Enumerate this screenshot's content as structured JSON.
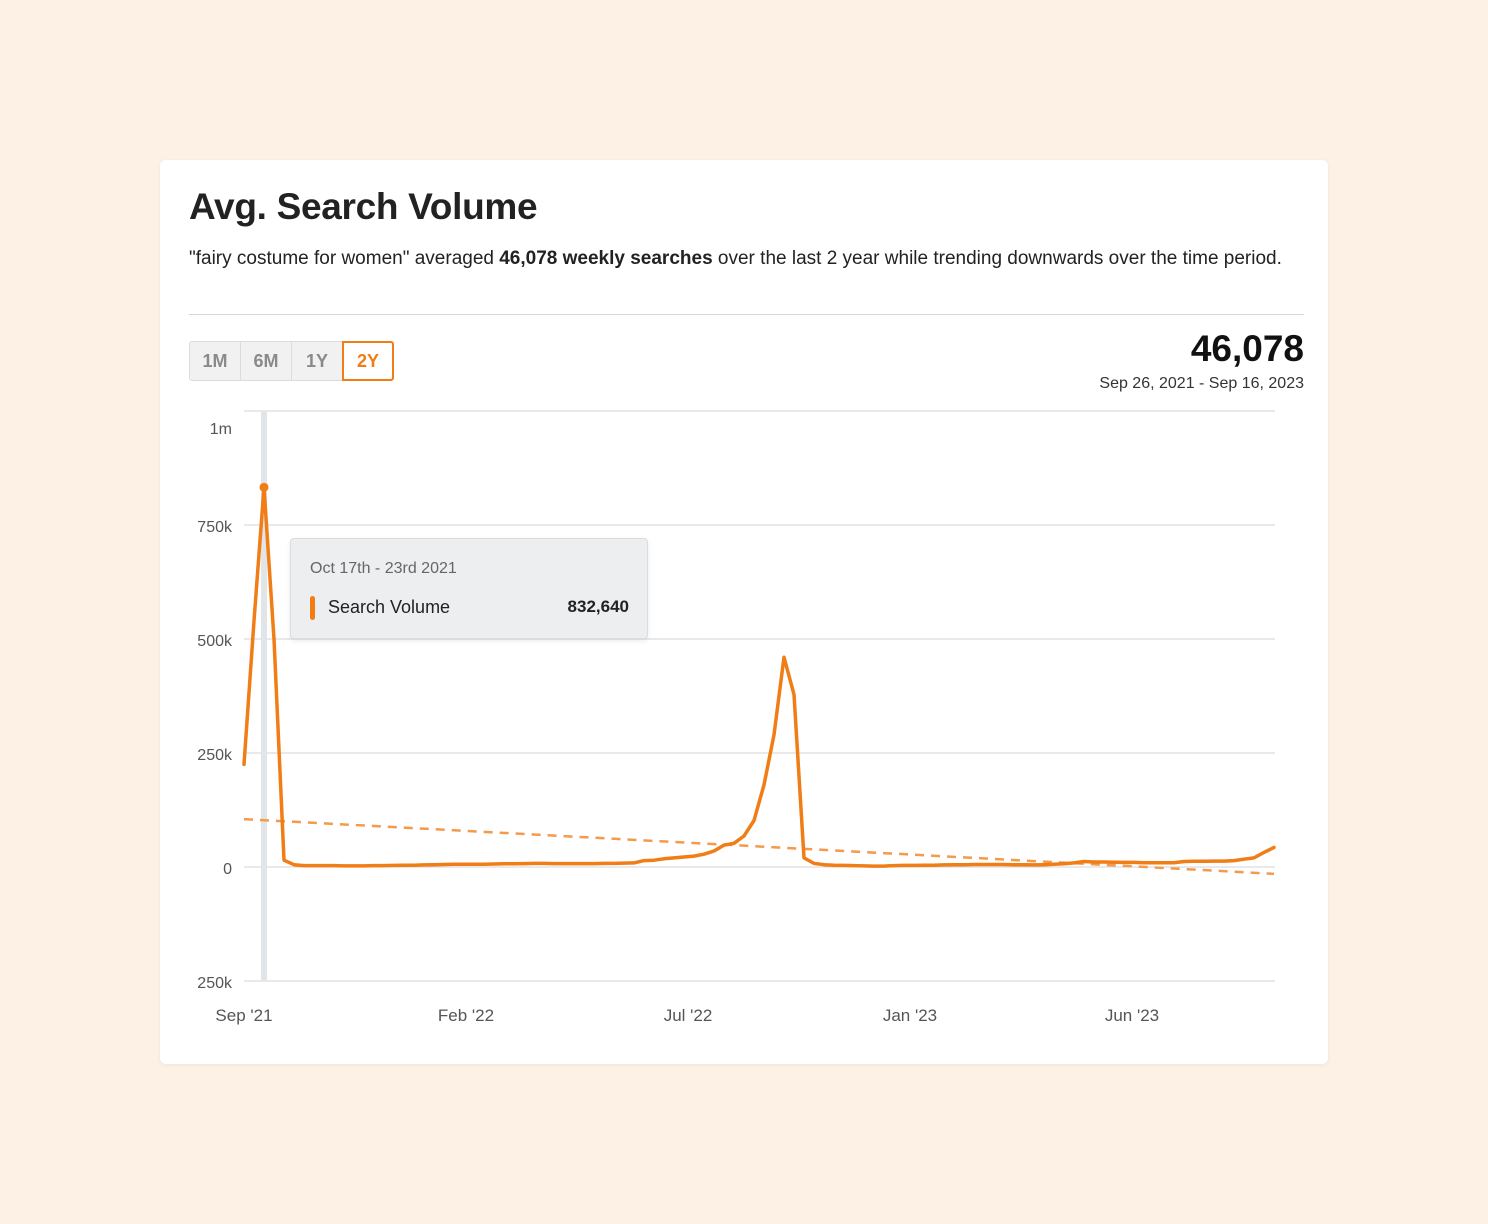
{
  "card": {
    "title": "Avg. Search Volume",
    "desc_pre": "\"fairy costume for women\" averaged ",
    "desc_bold": "46,078 weekly searches",
    "desc_post": " over the last 2 year while trending downwards over the time period."
  },
  "range_buttons": [
    "1M",
    "6M",
    "1Y",
    "2Y"
  ],
  "active_range": "2Y",
  "summary": {
    "value": "46,078",
    "date_range": "Sep 26, 2021 - Sep 16, 2023"
  },
  "tooltip": {
    "date": "Oct 17th - 23rd 2021",
    "series": "Search Volume",
    "value": "832,640"
  },
  "colors": {
    "accent": "#f07d16",
    "trend": "#f39a4c",
    "grid": "#d3d3d3",
    "cursor": "#e2e5e8"
  },
  "chart_data": {
    "type": "line",
    "y_tick_labels": [
      "1m",
      "750k",
      "500k",
      "250k",
      "0",
      "250k"
    ],
    "y_tick_values": [
      1000000,
      750000,
      500000,
      250000,
      0,
      -250000
    ],
    "x_tick_labels": [
      "Sep '21",
      "Feb '22",
      "Jul '22",
      "Jan '23",
      "Jun '23"
    ],
    "ylim": [
      -250000,
      1000000
    ],
    "grid": true,
    "series": [
      {
        "name": "Search Volume",
        "values": [
          225000,
          540000,
          832640,
          500000,
          15000,
          5000,
          3000,
          3000,
          3000,
          3000,
          2500,
          2500,
          2500,
          3000,
          3000,
          3500,
          4000,
          4000,
          4500,
          5000,
          5500,
          6000,
          6000,
          6000,
          6000,
          6500,
          7000,
          7000,
          7500,
          8000,
          8000,
          7500,
          7500,
          7500,
          7500,
          7500,
          8000,
          8000,
          8500,
          9000,
          14000,
          15000,
          18000,
          20000,
          22000,
          24000,
          28000,
          35000,
          48000,
          52000,
          68000,
          102000,
          180000,
          290000,
          460000,
          378000,
          20000,
          8000,
          5000,
          4000,
          3500,
          3000,
          2500,
          2000,
          2000,
          3000,
          3500,
          3500,
          4000,
          4000,
          4500,
          5000,
          5000,
          5500,
          5500,
          5500,
          5500,
          5000,
          5000,
          4500,
          5000,
          6000,
          7000,
          9000,
          12000,
          11000,
          11000,
          10500,
          10000,
          10000,
          9500,
          9500,
          9500,
          9500,
          12000,
          12500,
          12500,
          13000,
          13000,
          14000,
          17000,
          20000,
          32000,
          43000
        ]
      },
      {
        "name": "Trend",
        "start_value": 105000,
        "end_value": -15000
      }
    ],
    "highlight_index": 2
  }
}
